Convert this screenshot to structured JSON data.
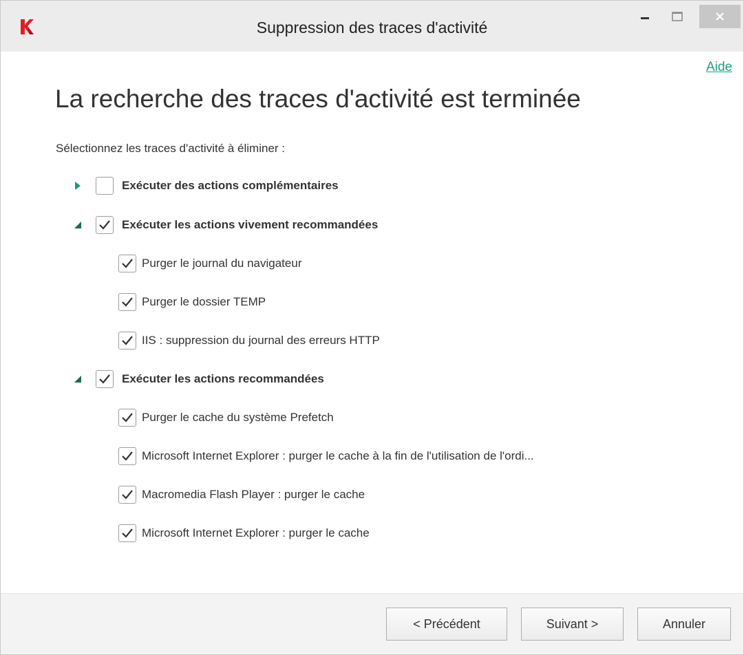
{
  "window": {
    "title": "Suppression des traces d'activité",
    "minimize_icon": "minimize-icon",
    "maximize_icon": "maximize-icon",
    "close_icon": "close-icon",
    "close_color": "#c7c7c7"
  },
  "help_link": "Aide",
  "heading": "La recherche des traces d'activité est terminée",
  "instruction": "Sélectionnez les traces d'activité à éliminer :",
  "accent_color": "#1aa083",
  "tree": {
    "group_additional": {
      "label": "Exécuter des actions complémentaires",
      "checked": false,
      "expanded": false
    },
    "group_strongly": {
      "label": "Exécuter les actions vivement recommandées",
      "checked": true,
      "expanded": true,
      "items": [
        {
          "label": "Purger le journal du navigateur",
          "checked": true
        },
        {
          "label": "Purger le dossier TEMP",
          "checked": true
        },
        {
          "label": "IIS : suppression du journal des erreurs HTTP",
          "checked": true
        }
      ]
    },
    "group_recommended": {
      "label": "Exécuter les actions recommandées",
      "checked": true,
      "expanded": true,
      "items": [
        {
          "label": "Purger le cache du système Prefetch",
          "checked": true
        },
        {
          "label": "Microsoft Internet Explorer : purger le cache à la fin de l'utilisation de l'ordi...",
          "checked": true
        },
        {
          "label": "Macromedia Flash Player : purger le cache",
          "checked": true
        },
        {
          "label": "Microsoft Internet Explorer : purger le cache",
          "checked": true
        }
      ]
    }
  },
  "buttons": {
    "previous": "< Précédent",
    "next": "Suivant >",
    "cancel": "Annuler"
  }
}
